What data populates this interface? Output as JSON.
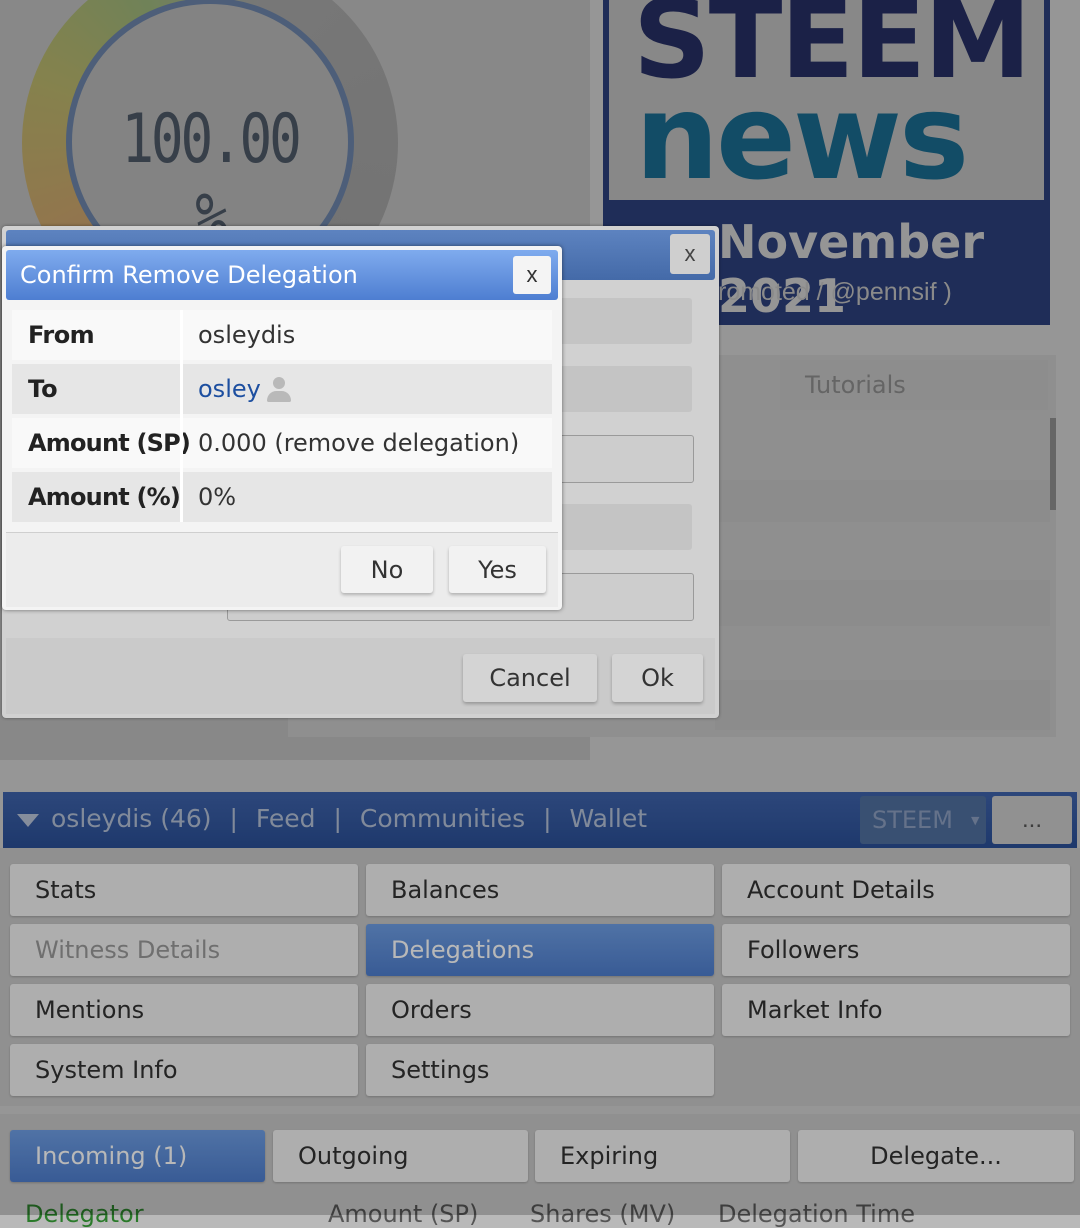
{
  "gauge": {
    "value": "100.00 %"
  },
  "banner": {
    "line1": "STEEM",
    "line2": "news",
    "date": "November 2021",
    "promoted": "romoted / @pennsif )"
  },
  "right_tabs": {
    "tutorials": "Tutorials"
  },
  "back_dialog": {
    "close": "x",
    "cancel": "Cancel",
    "ok": "Ok"
  },
  "confirm_dialog": {
    "title": "Confirm Remove Delegation",
    "close": "x",
    "rows": [
      {
        "label": "From",
        "value": "osleydis"
      },
      {
        "label": "To",
        "value": "osley"
      },
      {
        "label": "Amount (SP)",
        "value": "0.000 (remove delegation)"
      },
      {
        "label": "Amount (%)",
        "value": "0%"
      }
    ],
    "no": "No",
    "yes": "Yes"
  },
  "nav": {
    "account": "osleydis (46)",
    "sep": "|",
    "feed": "Feed",
    "communities": "Communities",
    "wallet": "Wallet",
    "currency": "STEEM",
    "more": "..."
  },
  "menu": [
    {
      "label": "Stats"
    },
    {
      "label": "Balances"
    },
    {
      "label": "Account Details"
    },
    {
      "label": "Witness Details"
    },
    {
      "label": "Delegations"
    },
    {
      "label": "Followers"
    },
    {
      "label": "Mentions"
    },
    {
      "label": "Orders"
    },
    {
      "label": "Market Info"
    },
    {
      "label": "System Info"
    },
    {
      "label": "Settings"
    }
  ],
  "deleg_tabs": {
    "incoming": "Incoming (1)",
    "outgoing": "Outgoing",
    "expiring": "Expiring",
    "delegate": "Delegate..."
  },
  "table_header": {
    "delegator": "Delegator",
    "amount": "Amount (SP)",
    "shares": "Shares (MV)",
    "time": "Delegation Time"
  },
  "colors": {
    "accent": "#4f7fcf",
    "nav_bg": "#2f55a0",
    "banner_blue": "#2b3f86",
    "banner_cyan": "#1a8fbf",
    "link": "#1d4fa0",
    "delegator_green": "#1a8f1a"
  }
}
